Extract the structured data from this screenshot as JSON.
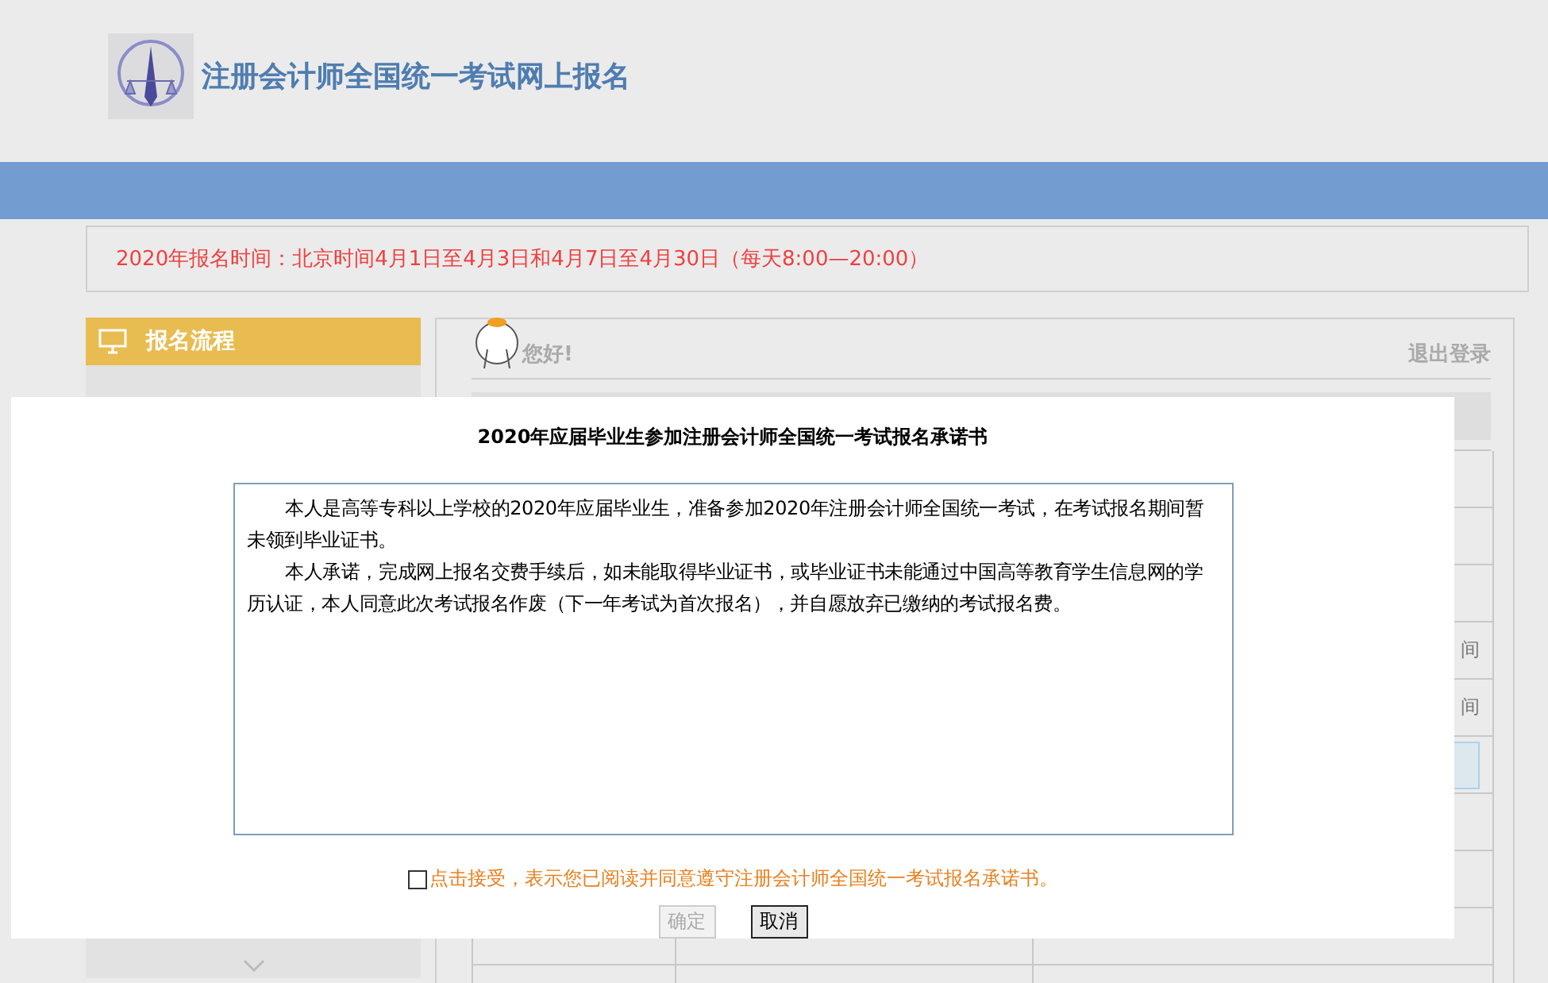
{
  "header": {
    "title": "注册会计师全国统一考试网上报名"
  },
  "notice": "2020年报名时间：北京时间4月1日至4月3日和4月7日至4月30日（每天8:00—20:00）",
  "sidebar": {
    "title": "报名流程"
  },
  "main": {
    "greeting": "您好!",
    "logout": "退出登录",
    "rows": [
      {
        "kind": "plain"
      },
      {
        "kind": "plain"
      },
      {
        "kind": "plain"
      },
      {
        "kind": "text",
        "text": "间"
      },
      {
        "kind": "text",
        "text": "间"
      },
      {
        "kind": "input"
      },
      {
        "kind": "plain"
      },
      {
        "kind": "plain"
      },
      {
        "kind": "plain"
      },
      {
        "kind": "plain"
      }
    ]
  },
  "dialog": {
    "title": "2020年应届毕业生参加注册会计师全国统一考试报名承诺书",
    "paragraphs": [
      "本人是高等专科以上学校的2020年应届毕业生，准备参加2020年注册会计师全国统一考试，在考试报名期间暂未领到毕业证书。",
      "本人承诺，完成网上报名交费手续后，如未能取得毕业证书，或毕业证书未能通过中国高等教育学生信息网的学历认证，本人同意此次考试报名作废（下一年考试为首次报名），并自愿放弃已缴纳的考试报名费。"
    ],
    "agreement": {
      "label": "点击接受，表示您已阅读并同意遵守注册会计师全国统一考试报名承诺书。",
      "checked": false
    },
    "buttons": [
      {
        "label": "确定",
        "disabled": true
      },
      {
        "label": "取消",
        "disabled": false
      }
    ]
  }
}
